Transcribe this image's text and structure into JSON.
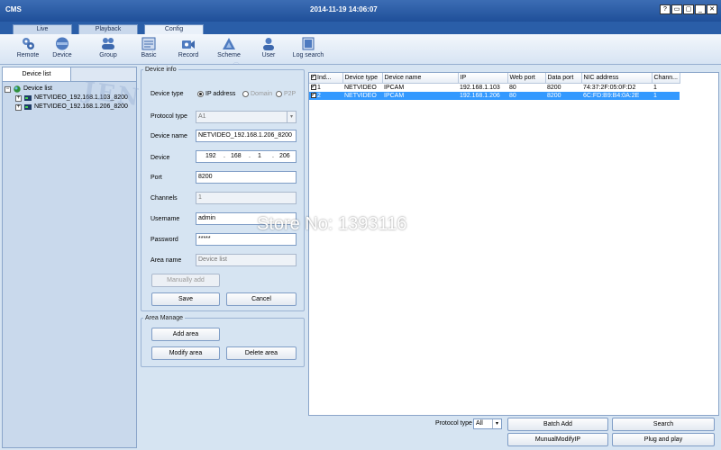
{
  "window": {
    "app_title": "CMS",
    "datetime": "2014-11-19 14:06:07",
    "buttons": [
      "?",
      "▭",
      "▢",
      "_",
      "✕"
    ]
  },
  "tabs": [
    {
      "label": "Live"
    },
    {
      "label": "Playback"
    },
    {
      "label": "Config",
      "active": true
    }
  ],
  "toolbar": [
    {
      "label": "Remote",
      "icon": "remote-icon"
    },
    {
      "label": "Device",
      "icon": "device-icon"
    },
    {
      "label": "Group",
      "icon": "group-icon"
    },
    {
      "label": "Basic",
      "icon": "basic-icon"
    },
    {
      "label": "Record",
      "icon": "record-icon"
    },
    {
      "label": "Scheme",
      "icon": "scheme-icon"
    },
    {
      "label": "User",
      "icon": "user-icon"
    },
    {
      "label": "Log search",
      "icon": "log-search-icon"
    }
  ],
  "tree": {
    "header": "Device list",
    "root": "Device list",
    "items": [
      "NETVIDEO_192.168.1.103_8200",
      "NETVIDEO_192.168.1.206_8200"
    ]
  },
  "watermark": {
    "logo_text": "JENU",
    "registered": "®"
  },
  "device_info": {
    "legend": "Device info",
    "device_type_label": "Device type",
    "device_type_options": [
      "IP address",
      "Domain",
      "P2P"
    ],
    "protocol_type_label": "Protocol type",
    "protocol_type_value": "A1",
    "device_name_label": "Device name",
    "device_name_value": "NETVIDEO_192.168.1.206_8200",
    "device_label": "Device",
    "ip_parts": [
      "192",
      "168",
      "1",
      "206"
    ],
    "ip_dot": ".",
    "port_label": "Port",
    "port_value": "8200",
    "channels_label": "Channels",
    "channels_value": "1",
    "username_label": "Username",
    "username_value": "admin",
    "password_label": "Password",
    "password_value": "*****",
    "area_name_label": "Area name",
    "area_name_value": "Device list",
    "manual_add": "Manually add",
    "save": "Save",
    "cancel": "Cancel"
  },
  "area_manage": {
    "legend": "Area Manage",
    "add_area": "Add area",
    "modify_area": "Modify area",
    "delete_area": "Delete area"
  },
  "device_table": {
    "columns": [
      "Ind...",
      "Device type",
      "Device name",
      "IP",
      "Web port",
      "Data port",
      "NIC address",
      "Chann..."
    ],
    "rows": [
      {
        "index": "1",
        "device_type": "NETVIDEO",
        "device_name": "IPCAM",
        "ip": "192.168.1.103",
        "web_port": "80",
        "data_port": "8200",
        "nic": "74:37:2F:05:0F:D2",
        "channels": "1",
        "checked": true,
        "selected": false
      },
      {
        "index": "2",
        "device_type": "NETVIDEO",
        "device_name": "IPCAM",
        "ip": "192.168.1.206",
        "web_port": "80",
        "data_port": "8200",
        "nic": "6C:FD:B9:B4:0A:2E",
        "channels": "1",
        "checked": true,
        "selected": true
      }
    ]
  },
  "store_watermark": "Store No: 1393116",
  "bottom": {
    "protocol_type_label": "Protocol type",
    "protocol_type_value": "All",
    "batch_add": "Batch Add",
    "search": "Search",
    "manual_modify_ip": "MunualModifyIP",
    "plug_and_play": "Plug and play"
  },
  "colors": {
    "title_bar": "#2a5ea8",
    "selection": "#3399ff",
    "panel_bg": "#d6e4f2"
  }
}
